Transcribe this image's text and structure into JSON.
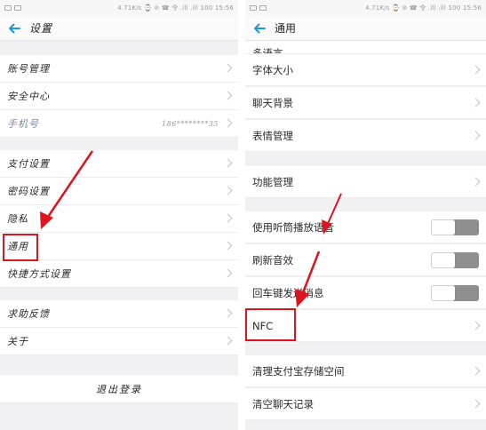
{
  "status_bar": {
    "left_text": "",
    "right_text": "4.71K/s  ⌚ ⊘ ☎ 令 .ill .ill 100  15:56"
  },
  "left_panel": {
    "title": "设置",
    "rows": [
      {
        "label": "账号管理"
      },
      {
        "label": "安全中心"
      },
      {
        "label": "手机号",
        "value": "186********35"
      },
      {
        "label": "支付设置"
      },
      {
        "label": "密码设置"
      },
      {
        "label": "隐私"
      },
      {
        "label": "通用"
      },
      {
        "label": "快捷方式设置"
      },
      {
        "label": "求助反馈"
      },
      {
        "label": "关于"
      }
    ],
    "logout_label": "退出登录"
  },
  "right_panel": {
    "title": "通用",
    "partial_row": "多语言",
    "rows": [
      {
        "label": "字体大小"
      },
      {
        "label": "聊天背景"
      },
      {
        "label": "表情管理"
      },
      {
        "label": "功能管理"
      },
      {
        "label": "使用听筒播放语音",
        "toggle": "off"
      },
      {
        "label": "刷新音效",
        "toggle": "off"
      },
      {
        "label": "回车键发送消息",
        "toggle": "off"
      },
      {
        "label": "NFC"
      },
      {
        "label": "清理支付宝存储空间"
      },
      {
        "label": "清空聊天记录"
      }
    ]
  },
  "colors": {
    "highlight": "#e0141e",
    "nav_arrow": "#1a9ad6"
  }
}
